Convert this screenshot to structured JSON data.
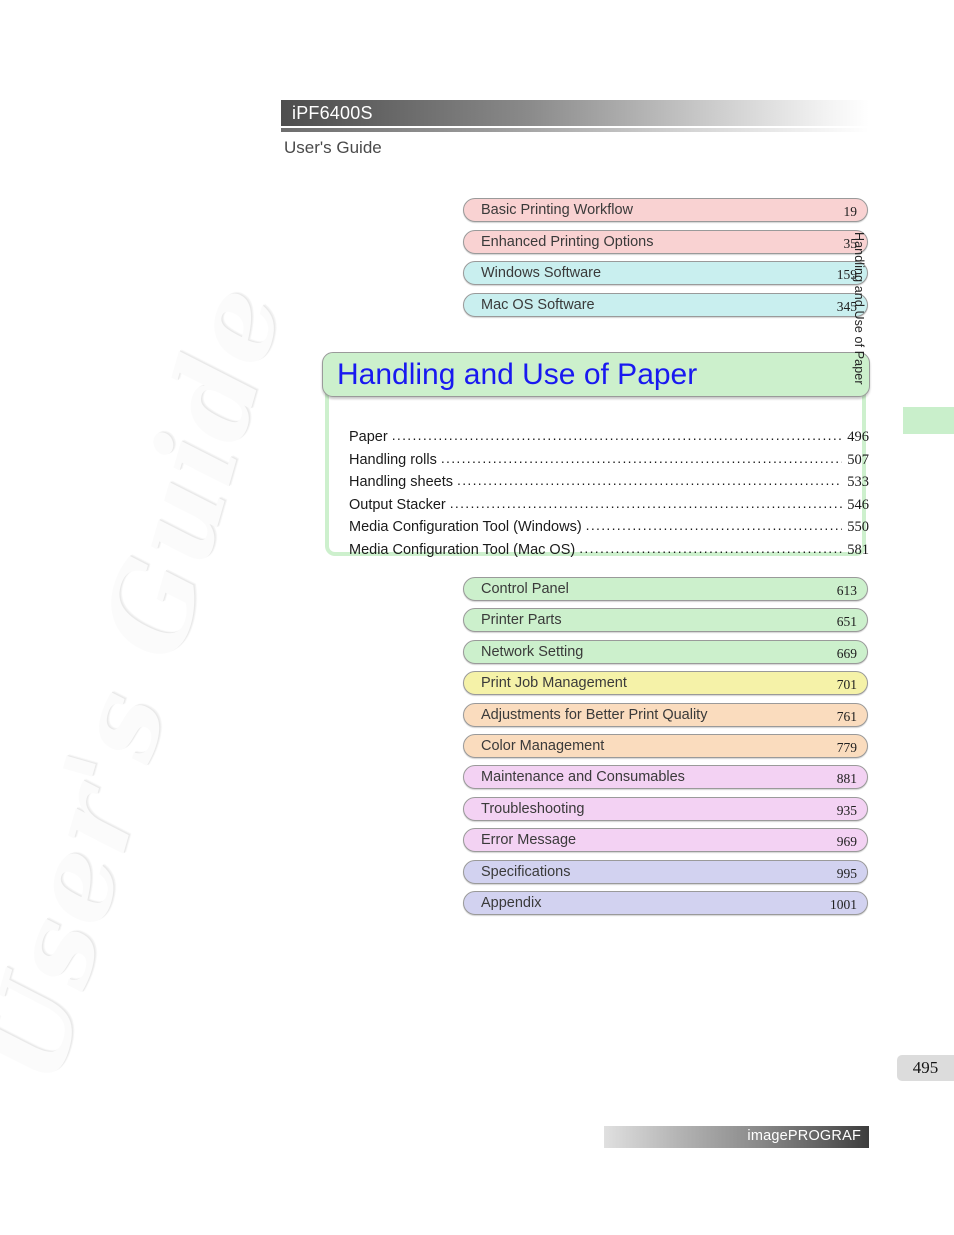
{
  "header": {
    "model": "iPF6400S",
    "subtitle": "User's Guide"
  },
  "side_tab": {
    "label": "Handling and Use of Paper",
    "marker_color": "#c9efcb"
  },
  "page_number": "495",
  "footer": {
    "brand": "imagePROGRAF"
  },
  "watermark": {
    "text": "User's Guide"
  },
  "chapters_top": [
    {
      "label": "Basic Printing Workflow",
      "page": "19",
      "color": "#f9d2d2"
    },
    {
      "label": "Enhanced Printing Options",
      "page": "35",
      "color": "#f9d2d2"
    },
    {
      "label": "Windows Software",
      "page": "159",
      "color": "#c9efef"
    },
    {
      "label": "Mac OS Software",
      "page": "345",
      "color": "#c9efef"
    }
  ],
  "feature_chapter": {
    "title": "Handling and Use of Paper",
    "title_color": "#1919f0",
    "background_color": "#ccf0cc",
    "entries": [
      {
        "label": "Paper",
        "page": "496"
      },
      {
        "label": "Handling rolls",
        "page": "507"
      },
      {
        "label": "Handling sheets",
        "page": "533"
      },
      {
        "label": "Output Stacker",
        "page": "546"
      },
      {
        "label": "Media Configuration Tool (Windows)",
        "page": "550"
      },
      {
        "label": "Media Configuration Tool (Mac OS)",
        "page": "581"
      }
    ],
    "leader": "......................................................................................................................................................."
  },
  "chapters_bottom": [
    {
      "label": "Control Panel",
      "page": "613",
      "color": "#ccf0cc"
    },
    {
      "label": "Printer Parts",
      "page": "651",
      "color": "#ccf0cc"
    },
    {
      "label": "Network Setting",
      "page": "669",
      "color": "#ccf0cc"
    },
    {
      "label": "Print Job Management",
      "page": "701",
      "color": "#f5f2a8"
    },
    {
      "label": "Adjustments for Better Print Quality",
      "page": "761",
      "color": "#fadcbe"
    },
    {
      "label": "Color Management",
      "page": "779",
      "color": "#fadcbe"
    },
    {
      "label": "Maintenance and Consumables",
      "page": "881",
      "color": "#f3d2f3"
    },
    {
      "label": "Troubleshooting",
      "page": "935",
      "color": "#f3d2f3"
    },
    {
      "label": "Error Message",
      "page": "969",
      "color": "#f3d2f3"
    },
    {
      "label": "Specifications",
      "page": "995",
      "color": "#d2d2f0"
    },
    {
      "label": "Appendix",
      "page": "1001",
      "color": "#d2d2f0"
    }
  ]
}
